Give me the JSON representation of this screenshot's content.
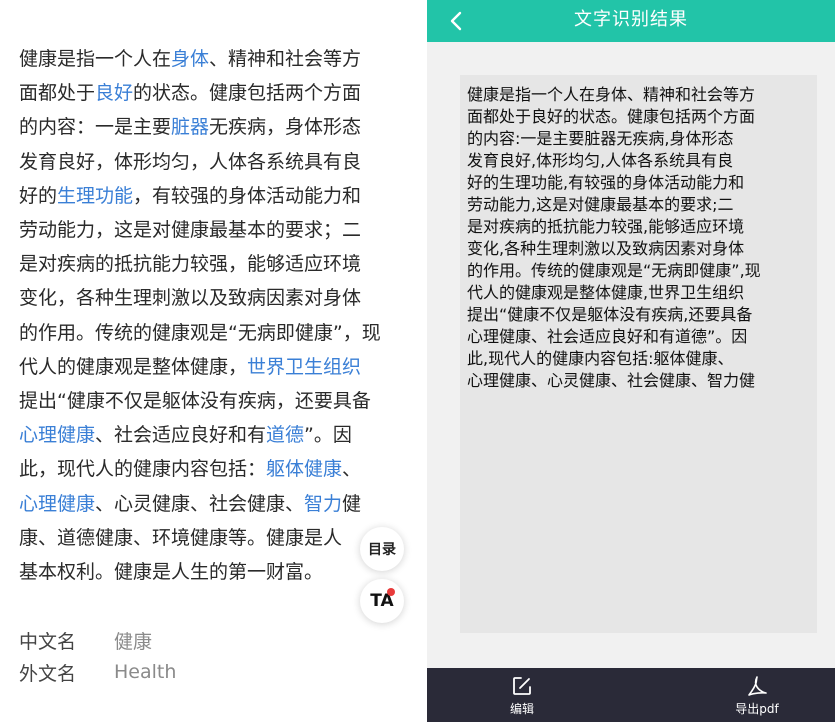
{
  "article": {
    "lines": [
      {
        "a": "健康是指一个人在",
        "link": "身体",
        "b": "、精神和社会等方"
      },
      {
        "a": "面都处于",
        "link": "良好",
        "b": "的状态。健康包括两个方面"
      },
      {
        "a": "的内容：一是主要",
        "link": "脏器",
        "b": "无疾病，身体形态"
      },
      {
        "a": "发育良好，体形均匀，人体各系统具有良",
        "link": "",
        "b": ""
      },
      {
        "a": "好的",
        "link": "生理功能",
        "b": "，有较强的身体活动能力和"
      },
      {
        "a": "劳动能力，这是对健康最基本的要求；二",
        "link": "",
        "b": ""
      },
      {
        "a": "是对疾病的抵抗能力较强，能够适应环境",
        "link": "",
        "b": ""
      },
      {
        "a": "变化，各种生理刺激以及致病因素对身体",
        "link": "",
        "b": ""
      },
      {
        "a": "的作用。传统的健康观是“无病即健康”，现",
        "link": "",
        "b": ""
      },
      {
        "a": "代人的健康观是整体健康，",
        "link": "世界卫生组织",
        "b": ""
      },
      {
        "a": "提出“健康不仅是躯体没有疾病，还要具备",
        "link": "",
        "b": ""
      },
      {
        "a": "",
        "link": "心理健康",
        "b": "、社会适应良好和有",
        "link2": "道德",
        "c": "”。因"
      },
      {
        "a": "此，现代人的健康内容包括：",
        "link": "躯体健康",
        "b": "、"
      },
      {
        "a": "",
        "link": "心理健康",
        "b": "、心灵健康、社会健康、",
        "link2": "智力",
        "c": "健"
      },
      {
        "a": "康、道德健康、环境健康等。健康是人",
        "link": "",
        "b": ""
      },
      {
        "a": "基本权利。健康是人生的第一财富。",
        "link": "",
        "b": ""
      }
    ],
    "meta": [
      {
        "key": "中文名",
        "value": "健康"
      },
      {
        "key": "外文名",
        "value": "Health"
      }
    ],
    "toc_label": "目录",
    "ta_label": "TA"
  },
  "ocr": {
    "title": "文字识别结果",
    "lines": [
      "健康是指一个人在身体、精神和社会等方",
      "面都处于良好的状态。健康包括两个方面",
      "的内容:一是主要脏器无疾病,身体形态",
      "发育良好,体形均匀,人体各系统具有良",
      "好的生理功能,有较强的身体活动能力和",
      "劳动能力,这是对健康最基本的要求;二",
      "是对疾病的抵抗能力较强,能够适应环境",
      "变化,各种生理刺激以及致病因素对身体",
      "的作用。传统的健康观是“无病即健康”,现",
      "代人的健康观是整体健康,世界卫生组织",
      "提出“健康不仅是躯体没有疾病,还要具备",
      "心理健康、社会适应良好和有道德”。因",
      "此,现代人的健康内容包括:躯体健康、",
      "心理健康、心灵健康、社会健康、智力健"
    ],
    "edit_label": "编辑",
    "export_label": "导出pdf"
  },
  "colors": {
    "header": "#22c4a8",
    "link": "#3a7fd6",
    "bottom_bar": "#2a2a38",
    "badge": "#e83b3b"
  },
  "icons": [
    "chevron-left-icon",
    "edit-icon",
    "pdf-icon"
  ]
}
